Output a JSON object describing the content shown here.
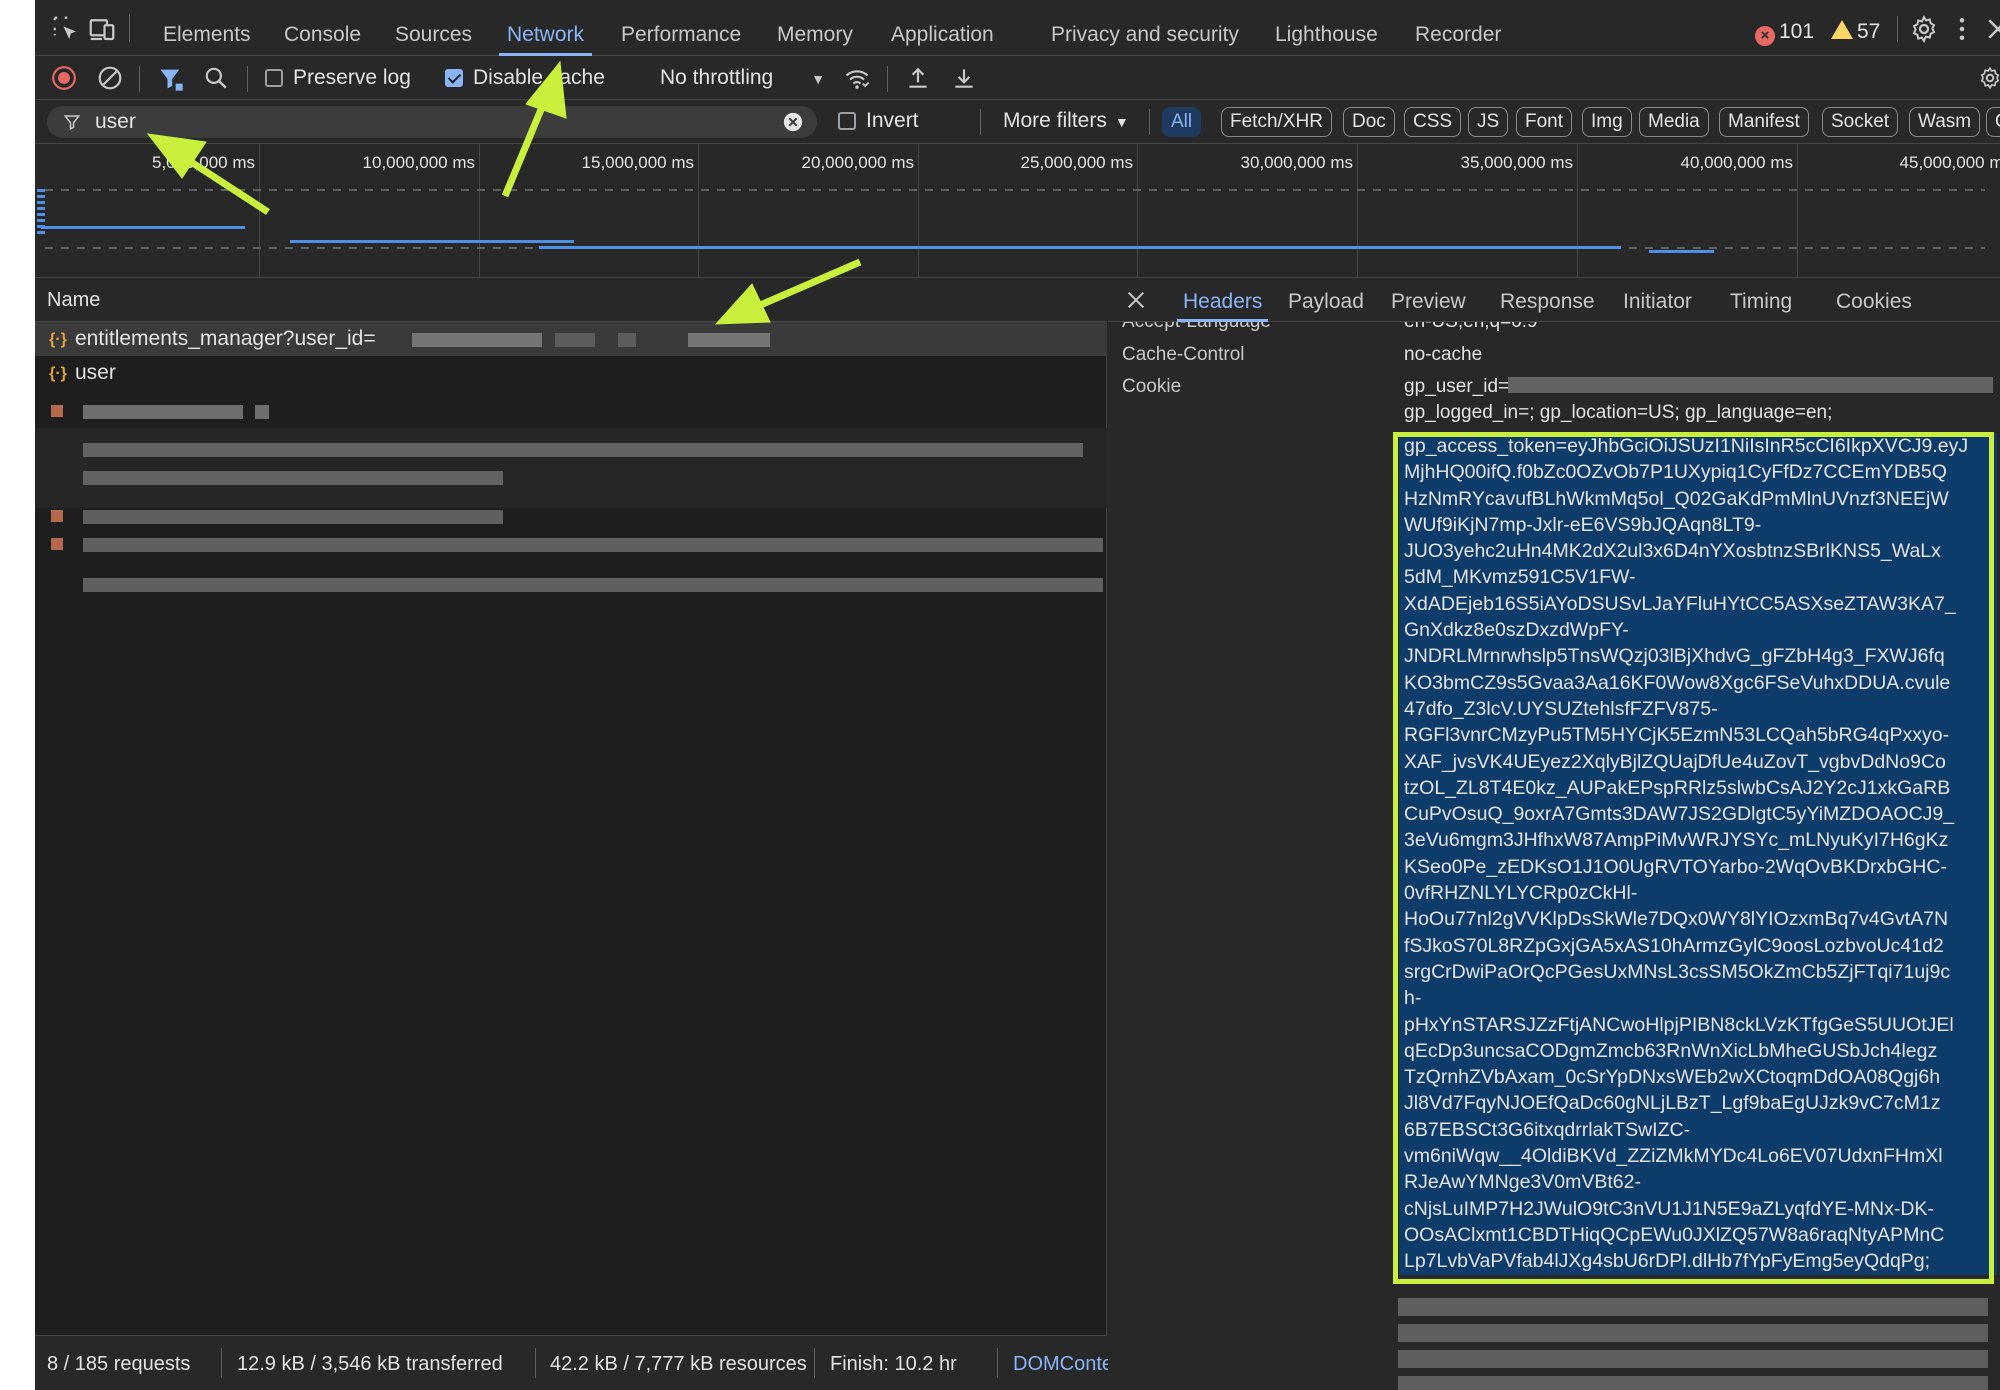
{
  "tabs": [
    "Elements",
    "Console",
    "Sources",
    "Network",
    "Performance",
    "Memory",
    "Application",
    "Privacy and security",
    "Lighthouse",
    "Recorder"
  ],
  "issues": {
    "errors": "101",
    "warnings": "57"
  },
  "toolbar": {
    "preserve_log": "Preserve log",
    "disable_cache": "Disable cache",
    "throttling": "No throttling"
  },
  "filter": {
    "value": "user",
    "invert": "Invert",
    "more_filters": "More filters"
  },
  "type_filters": [
    "All",
    "Fetch/XHR",
    "Doc",
    "CSS",
    "JS",
    "Font",
    "Img",
    "Media",
    "Manifest",
    "Socket",
    "Wasm",
    "Othe"
  ],
  "overview_ticks": [
    "5,000,000 ms",
    "10,000,000 ms",
    "15,000,000 ms",
    "20,000,000 ms",
    "25,000,000 ms",
    "30,000,000 ms",
    "35,000,000 ms",
    "40,000,000 ms",
    "45,000,000 ms"
  ],
  "requests": {
    "header": "Name",
    "rows": [
      {
        "name": "entitlements_manager?user_id=",
        "selected": true
      },
      {
        "name": "user",
        "selected": false
      }
    ]
  },
  "status": {
    "requests": "8 / 185 requests",
    "transferred": "12.9 kB / 3,546 kB transferred",
    "resources": "42.2 kB / 7,777 kB resources",
    "finish": "Finish: 10.2 hr",
    "domcontent": "DOMConter"
  },
  "details": {
    "tabs": [
      "Headers",
      "Payload",
      "Preview",
      "Response",
      "Initiator",
      "Timing",
      "Cookies"
    ],
    "partial_header": {
      "name": "Accept-Language",
      "value": "en-US,en;q=0.9"
    },
    "cache_control": {
      "name": "Cache-Control",
      "value": "no-cache"
    },
    "cookie_name": "Cookie",
    "cookie_line1": "gp_user_id=",
    "cookie_line2": "gp_logged_in=; gp_location=US; gp_language=en;",
    "token_lines": [
      "gp_access_token=eyJhbGciOiJSUzI1NiIsInR5cCI6IkpXVCJ9.eyJ",
      "MjhHQ00ifQ.f0bZc0OZvOb7P1UXypiq1CyFfDz7CCEmYDB5Q",
      "HzNmRYcavufBLhWkmMq5ol_Q02GaKdPmMlnUVnzf3NEEjW",
      "WUf9iKjN7mp-Jxlr-eE6VS9bJQAqn8LT9-",
      "JUO3yehc2uHn4MK2dX2ul3x6D4nYXosbtnzSBrlKNS5_WaLx",
      "5dM_MKvmz591C5V1FW-",
      "XdADEjeb16S5iAYoDSUSvLJaYFluHYtCC5ASXseZTAW3KA7_",
      "GnXdkz8e0szDxzdWpFY-",
      "JNDRLMrnrwhslp5TnsWQzj03lBjXhdvG_gFZbH4g3_FXWJ6fq",
      "KO3bmCZ9s5Gvaa3Aa16KF0Wow8Xgc6FSeVuhxDDUA.cvule",
      "47dfo_Z3lcV.UYSUZtehlsfFZFV875-",
      "RGFl3vnrCMzyPu5TM5HYCjK5EzmN53LCQah5bRG4qPxxyo-",
      "XAF_jvsVK4UEyez2XqlyBjlZQUajDfUe4uZovT_vgbvDdNo9Co",
      "tzOL_ZL8T4E0kz_AUPakEPspRRlz5slwbCsAJ2Y2cJ1xkGaRB",
      "CuPvOsuQ_9oxrA7Gmts3DAW7JS2GDlgtC5yYiMZDOAOCJ9_",
      "3eVu6mgm3JHfhxW87AmpPiMvWRJYSYc_mLNyuKyI7H6gKz",
      "KSeo0Pe_zEDKsO1J1O0UgRVTOYarbo-2WqOvBKDrxbGHC-",
      "0vfRHZNLYLYCRp0zCkHl-",
      "HoOu77nl2gVVKlpDsSkWle7DQx0WY8lYIOzxmBq7v4GvtA7N",
      "fSJkoS70L8RZpGxjGA5xAS10hArmzGylC9oosLozbvoUc41d2",
      "srgCrDwiPaOrQcPGesUxMNsL3csSM5OkZmCb5ZjFTqi71uj9c",
      "h-",
      "pHxYnSTARSJZzFtjANCwoHlpjPIBN8ckLVzKTfgGeS5UUOtJEl",
      "qEcDp3uncsaCODgmZmcb63RnWnXicLbMheGUSbJch4legz",
      "TzQrnhZVbAxam_0cSrYpDNxsWEb2wXCtoqmDdOA08Qgj6h",
      "Jl8Vd7FqyNJOEfQaDc60gNLjLBzT_Lgf9baEgUJzk9vC7cM1z",
      "6B7EBSCt3G6itxqdrrlakTSwIZC-",
      "vm6niWqw__4OldiBKVd_ZZiZMkMYDc4Lo6EV07UdxnFHmXl",
      "RJeAwYMNge3V0mVBt62-",
      "cNjsLuIMP7H2JWulO9tC3nVU1J1N5E9aZLyqfdYE-MNx-DK-",
      "OOsAClxmt1CBDTHiqQCpEWu0JXlZQ57W8a6raqNtyAPMnC",
      "Lp7LvbVaPVfab4lJXg4sbU6rDPl.dlHb7fYpFyEmg5eyQdqPg;"
    ]
  },
  "colors": {
    "accent": "#8ab4f8",
    "highlight_box": "#c8f03c",
    "arrow": "#c8f03c",
    "selection": "#0d3c6b"
  }
}
